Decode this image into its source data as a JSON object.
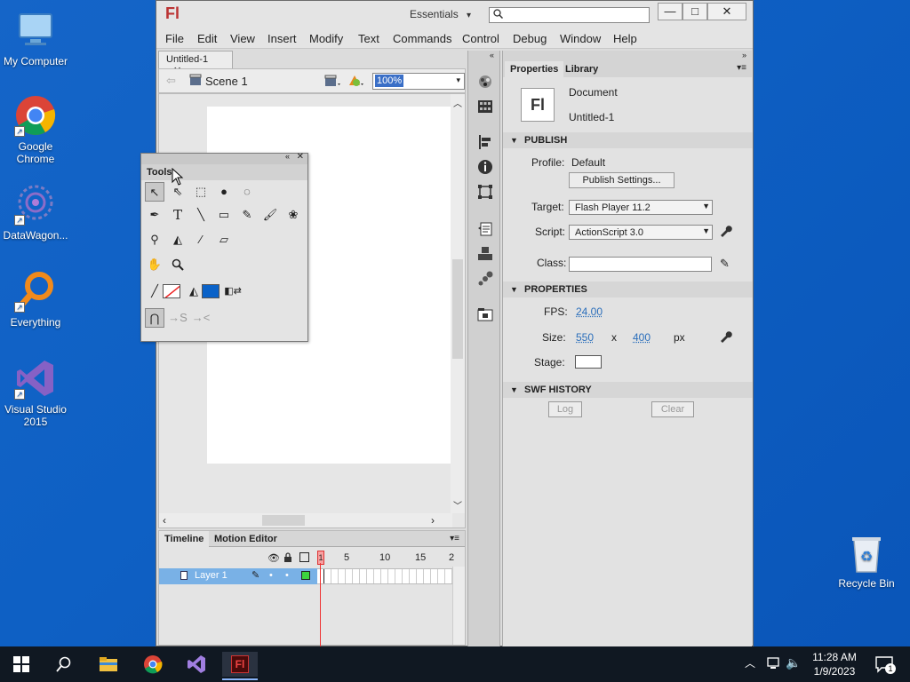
{
  "desktop": {
    "icons": [
      {
        "label": "My Computer"
      },
      {
        "label": "Google Chrome"
      },
      {
        "label": "DataWagon..."
      },
      {
        "label": "Everything"
      },
      {
        "label": "Visual Studio 2015"
      }
    ],
    "recycle_bin": "Recycle Bin"
  },
  "window": {
    "logo": "Fl",
    "workspace": "Essentials",
    "workspace_arrow": "▾",
    "min_glyph": "—",
    "max_glyph": "□",
    "close_glyph": "✕",
    "menu": [
      "File",
      "Edit",
      "View",
      "Insert",
      "Modify",
      "Text",
      "Commands",
      "Control",
      "Debug",
      "Window",
      "Help"
    ]
  },
  "document": {
    "tab_label": "Untitled-1",
    "scene": "Scene 1",
    "zoom": "100%"
  },
  "tools": {
    "title": "Tools"
  },
  "timeline": {
    "tabs": [
      "Timeline",
      "Motion Editor"
    ],
    "layer_name": "Layer 1",
    "frame_numbers": [
      "1",
      "5",
      "10",
      "15",
      "2"
    ]
  },
  "properties": {
    "tabs": [
      "Properties",
      "Library"
    ],
    "doc_icon": "Fl",
    "doc_type": "Document",
    "doc_name": "Untitled-1",
    "publish": {
      "section": "PUBLISH",
      "profile_label": "Profile:",
      "profile_value": "Default",
      "publish_settings": "Publish Settings...",
      "target_label": "Target:",
      "target_value": "Flash Player 11.2",
      "script_label": "Script:",
      "script_value": "ActionScript 3.0",
      "class_label": "Class:",
      "class_value": ""
    },
    "props": {
      "section": "PROPERTIES",
      "fps_label": "FPS:",
      "fps_value": "24.00",
      "size_label": "Size:",
      "width": "550",
      "x": "x",
      "height": "400",
      "unit": "px",
      "stage_label": "Stage:",
      "stage_color": "#ffffff"
    },
    "history": {
      "section": "SWF HISTORY",
      "log": "Log",
      "clear": "Clear"
    }
  },
  "taskbar": {
    "time": "11:28 AM",
    "date": "1/9/2023",
    "notif_count": "1"
  }
}
